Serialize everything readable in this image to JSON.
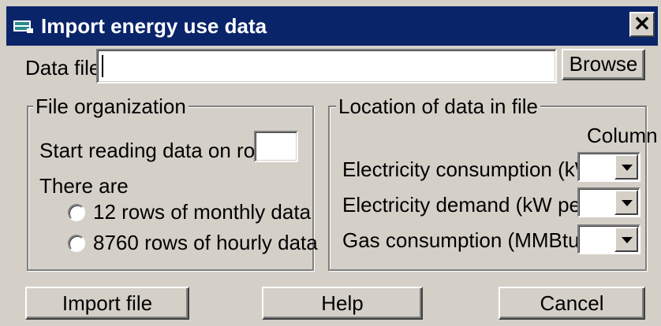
{
  "window": {
    "title": "Import energy use data",
    "close_glyph": "✕"
  },
  "data_file": {
    "label": "Data file:",
    "value": "",
    "browse_label": "Browse"
  },
  "file_organization": {
    "legend": "File organization",
    "start_row_label": "Start reading data on row #",
    "start_row_value": "",
    "there_are_label": "There are",
    "options": [
      {
        "label": "12 rows of monthly data",
        "selected": false
      },
      {
        "label": "8760 rows of hourly data",
        "selected": false
      }
    ]
  },
  "location": {
    "legend": "Location of data in file",
    "column_header": "Column",
    "rows": [
      {
        "label": "Electricity consumption (kWh)",
        "value": ""
      },
      {
        "label": "Electricity demand (kW peak)",
        "value": ""
      },
      {
        "label": "Gas consumption (MMBtu)",
        "value": ""
      }
    ]
  },
  "buttons": {
    "import": "Import file",
    "help": "Help",
    "cancel": "Cancel"
  },
  "colors": {
    "titlebar": "#0a246a",
    "face": "#d4d0c8"
  }
}
